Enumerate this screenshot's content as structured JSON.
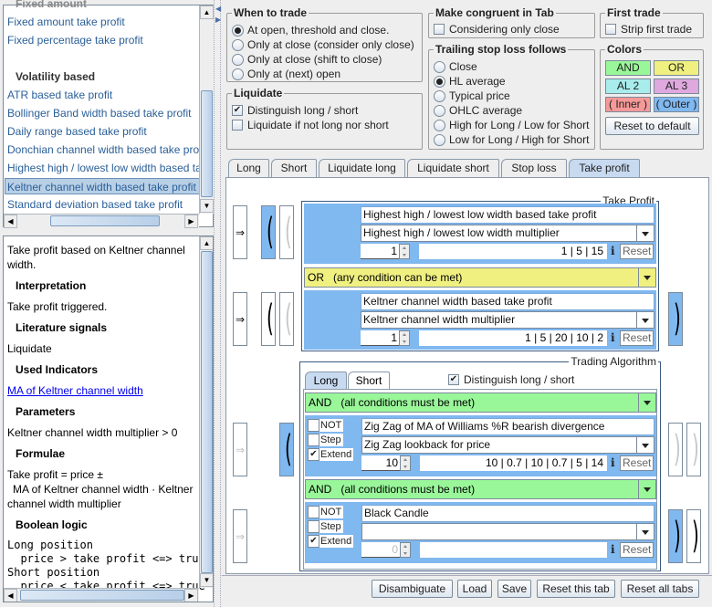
{
  "left_list": {
    "cut_header": "Fixed amount",
    "items": [
      {
        "label": "Fixed amount take profit",
        "type": "item"
      },
      {
        "label": "Fixed percentage take profit",
        "type": "item"
      },
      {
        "label": "",
        "type": "spacer"
      },
      {
        "label": "Volatility based",
        "type": "header"
      },
      {
        "label": "ATR based take profit",
        "type": "item"
      },
      {
        "label": "Bollinger Band width based take profit",
        "type": "item"
      },
      {
        "label": "Daily range based take profit",
        "type": "item"
      },
      {
        "label": "Donchian channel width based take profit",
        "type": "item"
      },
      {
        "label": "Highest high / lowest low width based take profit",
        "type": "item"
      },
      {
        "label": "Keltner channel width based take profit",
        "type": "item",
        "selected": true
      },
      {
        "label": "Standard deviation based take profit",
        "type": "item"
      }
    ]
  },
  "info": {
    "description_l1": "Take profit based on Keltner channel",
    "description_l2": "width.",
    "interpretation_h": "Interpretation",
    "interpretation": "Take profit triggered.",
    "literature_h": "Literature signals",
    "literature": "Liquidate",
    "indicators_h": "Used Indicators",
    "indicator_link": "MA of Keltner channel width",
    "parameters_h": "Parameters",
    "parameters": "Keltner channel width multiplier > 0",
    "formulae_h": "Formulae",
    "formula_l1": "Take profit = price ±",
    "formula_l2": "MA of Keltner channel width · Keltner",
    "formula_l3": "channel width multiplier",
    "boolean_h": "Boolean logic",
    "bool_l1": "Long position",
    "bool_l2": "  price > take profit <=> true",
    "bool_l3": "Short position",
    "bool_l4": "  price < take profit <=> true"
  },
  "when_to_trade": {
    "title": "When to trade",
    "options": [
      {
        "label": "At open, threshold and close.",
        "selected": true
      },
      {
        "label": "Only at close (consider only close)",
        "selected": false
      },
      {
        "label": "Only at close (shift to close)",
        "selected": false
      },
      {
        "label": "Only at (next) open",
        "selected": false
      }
    ]
  },
  "liquidate": {
    "title": "Liquidate",
    "distinguish": {
      "label": "Distinguish long / short",
      "checked": true
    },
    "if_not": {
      "label": "Liquidate if not long nor short",
      "checked": false
    }
  },
  "congruent": {
    "title": "Make congruent in Tab",
    "label": "Considering only close",
    "checked": false
  },
  "first_trade": {
    "title": "First trade",
    "label": "Strip first trade",
    "checked": false
  },
  "trailing": {
    "title": "Trailing stop loss follows",
    "options": [
      {
        "label": "Close",
        "selected": false
      },
      {
        "label": "HL average",
        "selected": true
      },
      {
        "label": "Typical price",
        "selected": false
      },
      {
        "label": "OHLC average",
        "selected": false
      },
      {
        "label": "High for Long / Low for Short",
        "selected": false
      },
      {
        "label": "Low for Long / High for Short",
        "selected": false
      }
    ]
  },
  "colors": {
    "title": "Colors",
    "and": {
      "label": "AND",
      "color": "#99f799"
    },
    "or": {
      "label": "OR",
      "color": "#f0f080"
    },
    "al2": {
      "label": "AL 2",
      "color": "#a8ecec"
    },
    "al3": {
      "label": "AL 3",
      "color": "#dfa8df"
    },
    "inner": {
      "label": "( Inner )",
      "color": "#f59999"
    },
    "outer": {
      "label": "( Outer )",
      "color": "#80b8f0"
    },
    "reset": "Reset to default"
  },
  "tabs": [
    "Long",
    "Short",
    "Liquidate long",
    "Liquidate short",
    "Stop loss",
    "Take profit"
  ],
  "active_tab": "Take profit",
  "take_profit": {
    "title": "Take Profit",
    "arrow": "⇒",
    "cond1": {
      "name": "Highest high / lowest low width based take profit",
      "param": "Highest high / lowest low width multiplier",
      "spin": "1",
      "values": "1 | 5 | 15",
      "info": "i",
      "reset": "Reset"
    },
    "logic": "OR   (any condition can be met)",
    "cond2": {
      "name": "Keltner channel width based take profit",
      "param": "Keltner channel width multiplier",
      "spin": "1",
      "values": "1 | 5 | 20 | 10 | 2",
      "info": "i",
      "reset": "Reset"
    }
  },
  "trading_algorithm": {
    "title": "Trading Algorithm",
    "tabs": [
      "Long",
      "Short"
    ],
    "active_tab": "Long",
    "distinguish": {
      "label": "Distinguish long / short",
      "checked": true
    },
    "logic1": "AND   (all conditions must be met)",
    "cond1": {
      "not": {
        "label": "NOT",
        "checked": false
      },
      "step": {
        "label": "Step",
        "checked": false
      },
      "extend": {
        "label": "Extend",
        "checked": true
      },
      "name": "Zig Zag of MA of Williams %R bearish divergence",
      "param": "Zig Zag lookback for price",
      "spin": "10",
      "values": "10 | 0.7 | 10 | 0.7 | 5 | 14",
      "info": "i",
      "reset": "Reset"
    },
    "logic2": "AND   (all conditions must be met)",
    "cond2": {
      "not": {
        "label": "NOT",
        "checked": false
      },
      "step": {
        "label": "Step",
        "checked": false
      },
      "extend": {
        "label": "Extend",
        "checked": true
      },
      "name": "Black Candle",
      "param": "",
      "spin": "0",
      "values": "",
      "info": "i",
      "reset": "Reset"
    }
  },
  "bottom_buttons": [
    "Disambiguate",
    "Load",
    "Save",
    "Reset this tab",
    "Reset all tabs"
  ],
  "check_mark": "✔"
}
